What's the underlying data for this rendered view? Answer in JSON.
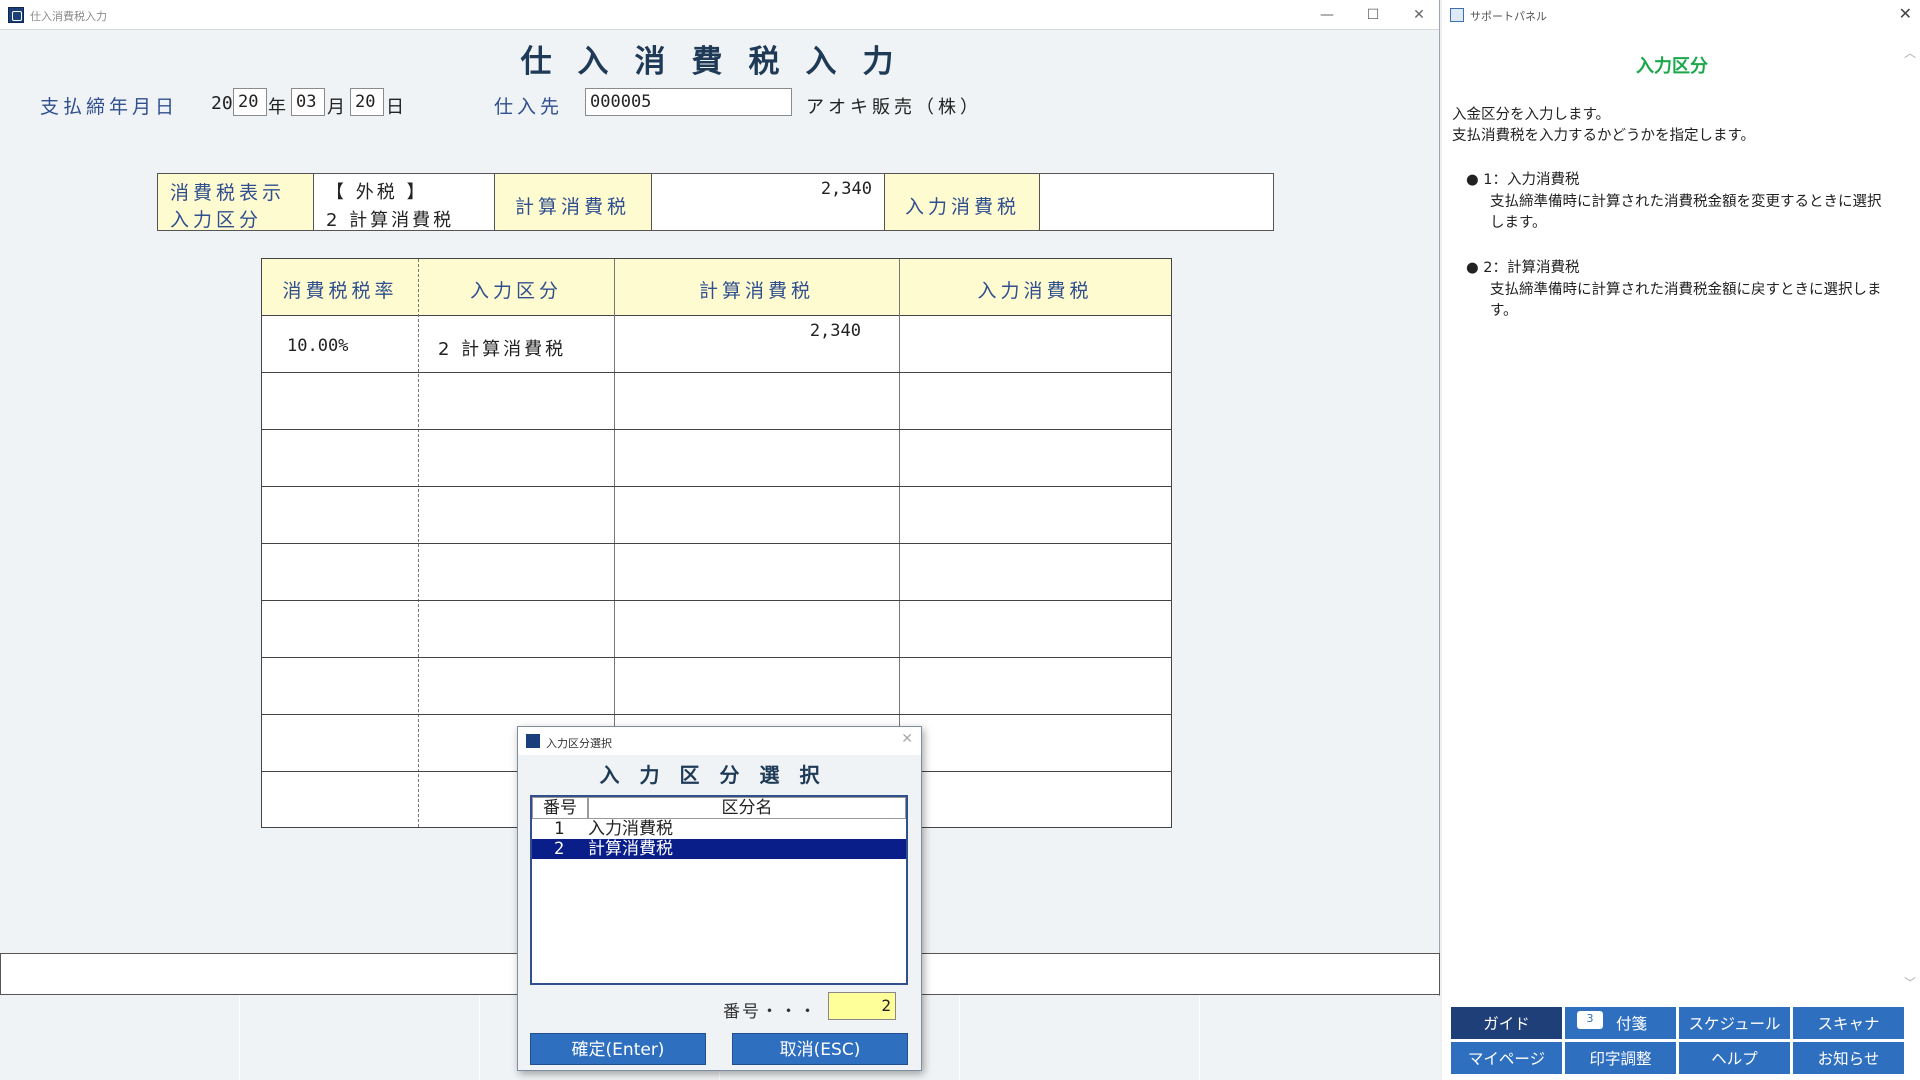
{
  "window": {
    "title": "仕入消費税入力",
    "min": "—",
    "max": "☐",
    "close": "✕"
  },
  "page_title": "仕入消費税入力",
  "header": {
    "date_label": "支払締年月日",
    "year_prefix": "20",
    "year_value": "20",
    "year_unit": "年",
    "month_value": "03",
    "month_unit": "月",
    "day_value": "20",
    "day_unit": "日",
    "supplier_label": "仕入先",
    "supplier_code": "000005",
    "supplier_name": "アオキ販売（株）"
  },
  "summary": {
    "tax_display_label": "消費税表示",
    "input_class_label": "入力区分",
    "tax_display_value": "【 外税 】",
    "input_class_value": "2 計算消費税",
    "calc_tax_label": "計算消費税",
    "calc_tax_value": "2,340",
    "input_tax_label": "入力消費税",
    "input_tax_value": ""
  },
  "grid": {
    "headers": [
      "消費税税率",
      "入力区分",
      "計算消費税",
      "入力消費税"
    ],
    "rows": [
      {
        "rate": "10.00%",
        "class": "2 計算消費税",
        "calc": "2,340",
        "input": ""
      }
    ]
  },
  "support_panel": {
    "title": "サポートパネル",
    "close": "✕",
    "heading": "入力区分",
    "intro_1": "入金区分を入力します。",
    "intro_2": "支払消費税を入力するかどうかを指定します。",
    "item1_title": "● 1：入力消費税",
    "item1_desc_1": "支払締準備時に計算された消費税金額を変更するときに選択",
    "item1_desc_2": "します。",
    "item2_title": "● 2：計算消費税",
    "item2_desc_1": "支払締準備時に計算された消費税金額に戻すときに選択しま",
    "item2_desc_2": "す。",
    "buttons": [
      "ガイド",
      "付箋",
      "スケジュール",
      "スキャナ",
      "マイページ",
      "印字調整",
      "ヘルプ",
      "お知らせ"
    ],
    "badge_count": "3",
    "scroll_up": "︿",
    "scroll_down": "﹀"
  },
  "dialog": {
    "title": "入力区分選択",
    "close": "✕",
    "heading": "入力区分選択",
    "col_num": "番号",
    "col_name": "区分名",
    "options": [
      {
        "num": "1",
        "name": "入力消費税"
      },
      {
        "num": "2",
        "name": "計算消費税"
      }
    ],
    "number_label": "番号・・・",
    "number_value": "2",
    "confirm_label": "確定(Enter)",
    "cancel_label": "取消(ESC)"
  }
}
